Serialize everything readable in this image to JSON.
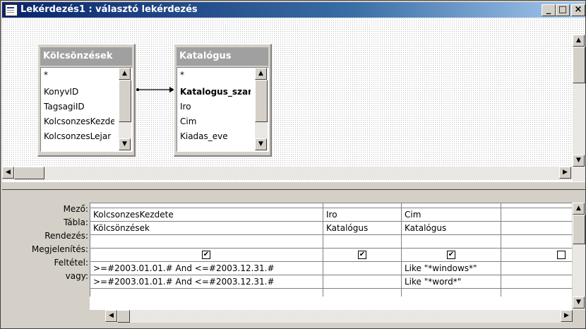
{
  "window": {
    "title": "Lekérdezés1 : választó lekérdezés",
    "buttons": {
      "minimize": "_",
      "maximize": "□",
      "close": "×"
    }
  },
  "tables": [
    {
      "name": "Kölcsönzések",
      "fields": [
        "*",
        "KonyvID",
        "TagsagiID",
        "KolcsonzesKezdete",
        "KolcsonzesLejar"
      ]
    },
    {
      "name": "Katalógus",
      "fields": [
        "*",
        "Katalogus_szam",
        "Iro",
        "Cim",
        "Kiadas_eve"
      ],
      "bold_index": 1
    }
  ],
  "grid": {
    "row_labels": [
      "Mező:",
      "Tábla:",
      "Rendezés:",
      "Megjelenítés:",
      "Feltétel:",
      "vagy:"
    ],
    "columns": [
      {
        "field": "KolcsonzesKezdete",
        "table": "Kölcsönzések",
        "sort": "",
        "show": true,
        "criteria": ">=#2003.01.01.# And <=#2003.12.31.#",
        "or": ">=#2003.01.01.# And <=#2003.12.31.#"
      },
      {
        "field": "Iro",
        "table": "Katalógus",
        "sort": "",
        "show": true,
        "criteria": "",
        "or": ""
      },
      {
        "field": "Cim",
        "table": "Katalógus",
        "sort": "",
        "show": true,
        "criteria": "Like \"*windows*\"",
        "or": "Like \"*word*\""
      },
      {
        "field": "",
        "table": "",
        "sort": "",
        "show": false,
        "criteria": "",
        "or": ""
      }
    ]
  },
  "icons": [
    "query-window-icon",
    "scroll-up-arrow-icon",
    "scroll-down-arrow-icon",
    "scroll-left-arrow-icon",
    "scroll-right-arrow-icon",
    "checkbox-icon",
    "relationship-arrow-icon"
  ]
}
